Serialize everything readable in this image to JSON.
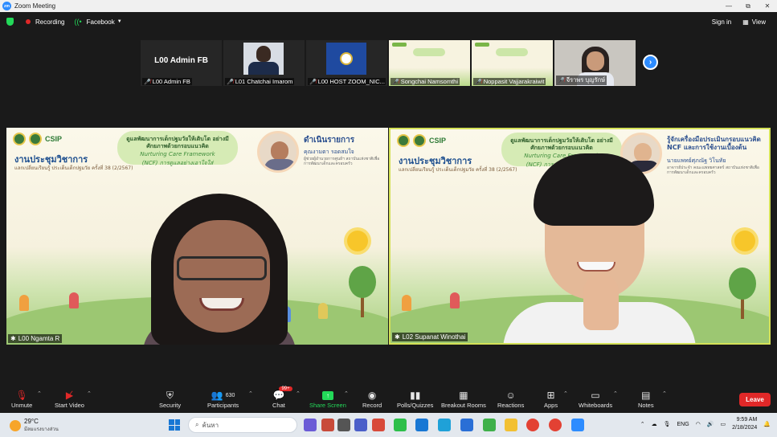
{
  "window": {
    "title": "Zoom Meeting",
    "controls": [
      "—",
      "□",
      "✕"
    ],
    "restore_glyph": "⧉"
  },
  "topbar": {
    "recording_label": "Recording",
    "stream_label": "Facebook",
    "sign_in": "Sign in",
    "view": "View"
  },
  "participants_strip": [
    {
      "name": "L00 Admin FB",
      "display_text": "L00 Admin FB",
      "kind": "text"
    },
    {
      "name": "L01 Chatchai Imarom",
      "kind": "person"
    },
    {
      "name": "L00 HOST ZOOM_NIC...",
      "kind": "logo"
    },
    {
      "name": "Songchai Namsomthi",
      "kind": "slide"
    },
    {
      "name": "Noppasit Vajjarakraiwit",
      "kind": "slide"
    },
    {
      "name": "จีราพร บุญรักษ์",
      "kind": "camera"
    }
  ],
  "tiles": {
    "left": {
      "name": "L00 Ngamta R",
      "slide_title_th": "ดูแลพัฒนาการเด็กปฐมวัยให้เติบโต อย่างมีศักยภาพด้วยกรอบแนวคิด",
      "slide_title_en": "Nurturing Care Framework",
      "slide_title_ncp": "(NCF) การดูแลอย่างเอาใจใส่",
      "meeting_title": "งานประชุมวิชาการ",
      "meeting_sub": "แลกเปลี่ยนเรียนรู้ ประเด็นเด็กปฐมวัย ครั้งที่ 38 (2/2567)",
      "speaker_role": "ดำเนินรายการ",
      "speaker_name": "คุณงามตา รอดสมใจ",
      "speaker_aff": "ผู้ช่วยผู้อำนวยการศูนย์ฯ สถาบันแห่งชาติเพื่อการพัฒนาเด็กและครอบครัว",
      "csip": "CSIP"
    },
    "right": {
      "name": "L02 Supanat Winothai",
      "slide_title_th": "ดูแลพัฒนาการเด็กปฐมวัยให้เติบโต อย่างมีศักยภาพด้วยกรอบแนวคิด",
      "slide_title_en": "Nurturing Care Framework",
      "slide_title_ncp": "(NCF) การดูแลอย่างเอาใจใส่",
      "meeting_title": "งานประชุมวิชาการ",
      "meeting_sub": "แลกเปลี่ยนเรียนรู้ ประเด็นเด็กปฐมวัย ครั้งที่ 38 (2/2567)",
      "speaker_role": "รู้จักเครื่องมือประเมินกรอบแนวคิด NCF และการใช้งานเบื้องต้น",
      "speaker_name": "นายแพทย์ศุภณัฐ วิโนทัย",
      "speaker_aff": "อาจารย์ประจำ คณะแพทยศาสตร์ สถาบันแห่งชาติเพื่อการพัฒนาเด็กและครอบครัว",
      "csip": "CSIP"
    }
  },
  "toolbar": {
    "unmute": "Unmute",
    "start_video": "Start Video",
    "security": "Security",
    "participants": "Participants",
    "participants_count": "630",
    "chat": "Chat",
    "chat_badge": "99+",
    "share_screen": "Share Screen",
    "record": "Record",
    "polls": "Polls/Quizzes",
    "breakout": "Breakout Rooms",
    "reactions": "Reactions",
    "apps": "Apps",
    "whiteboards": "Whiteboards",
    "notes": "Notes",
    "leave": "Leave"
  },
  "taskbar": {
    "temperature": "29°C",
    "weather_desc": "มีลมแรงบางส่วน",
    "search_placeholder": "ค้นหา",
    "language": "ENG",
    "time": "9:59 AM",
    "date": "2/18/2024"
  },
  "colors": {
    "zoom_blue": "#2d8cff",
    "record_red": "#e02828",
    "share_green": "#23d959",
    "active_speaker_border": "#d4e157"
  }
}
